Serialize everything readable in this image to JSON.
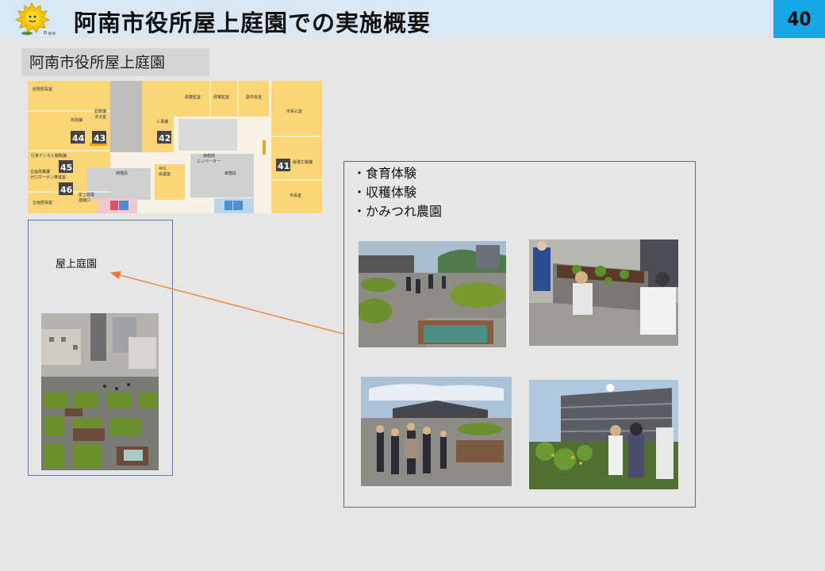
{
  "header": {
    "title": "阿南市役所屋上庭園での実施概要",
    "page_number": "40",
    "mascot_icon": "sun-mascot-icon",
    "background_color": "#d9e7f3",
    "page_number_color": "#17a6e6"
  },
  "location_label": "阿南市役所屋上庭園",
  "floor_map": {
    "rooms": [
      {
        "label": "総務部長室"
      },
      {
        "label": "財政課"
      },
      {
        "label": "総務課 法令室"
      },
      {
        "label": "人事課"
      },
      {
        "label": "政策監室"
      },
      {
        "label": "副市長室"
      },
      {
        "label": "市長公室"
      },
      {
        "label": "行革デジタル戦略課"
      },
      {
        "label": "企画政策課 ゼロカーボン推進室"
      },
      {
        "label": "401 会議室"
      },
      {
        "label": "南側部 エレベーター"
      },
      {
        "label": "西階段"
      },
      {
        "label": "東階段"
      },
      {
        "label": "秘書広報課"
      },
      {
        "label": "市長室"
      },
      {
        "label": "企画部長室"
      },
      {
        "label": "屋上庭園 連絡口"
      }
    ],
    "room_numbers": [
      "44",
      "43",
      "42",
      "45",
      "46",
      "41"
    ],
    "accent_color": "#fbd576"
  },
  "rooftop": {
    "label": "屋上庭園",
    "arrow_color": "#ed7d31"
  },
  "activities": [
    "・食育体験",
    "・収穫体験",
    "・かみつれ農園"
  ]
}
